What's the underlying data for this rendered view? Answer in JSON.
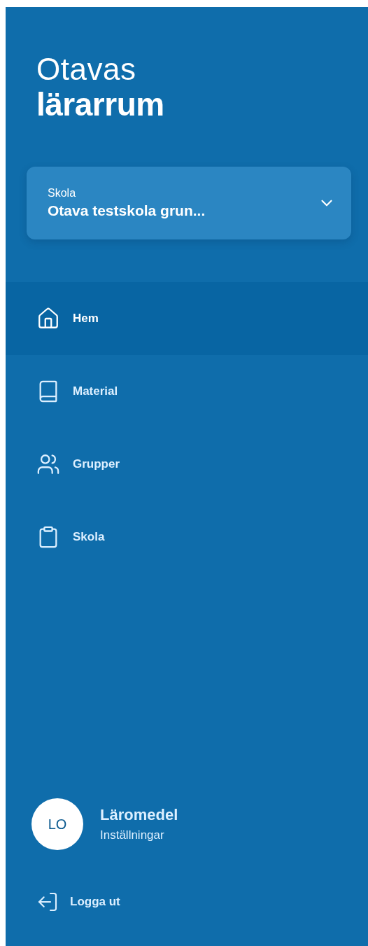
{
  "logo": {
    "line_1": "Otavas",
    "line_2": "lärarrum"
  },
  "school_select": {
    "label": "Skola",
    "value": "Otava testskola grun..."
  },
  "nav": [
    {
      "kind": "home",
      "label": "Hem",
      "selected": true
    },
    {
      "kind": "book",
      "label": "Material",
      "selected": false
    },
    {
      "kind": "users",
      "label": "Grupper",
      "selected": false
    },
    {
      "kind": "clipboard",
      "label": "Skola",
      "selected": false
    }
  ],
  "profile": {
    "initials": "LO",
    "name": "Läromedel",
    "link": "Inställningar"
  },
  "logout": {
    "label": "Logga ut"
  }
}
